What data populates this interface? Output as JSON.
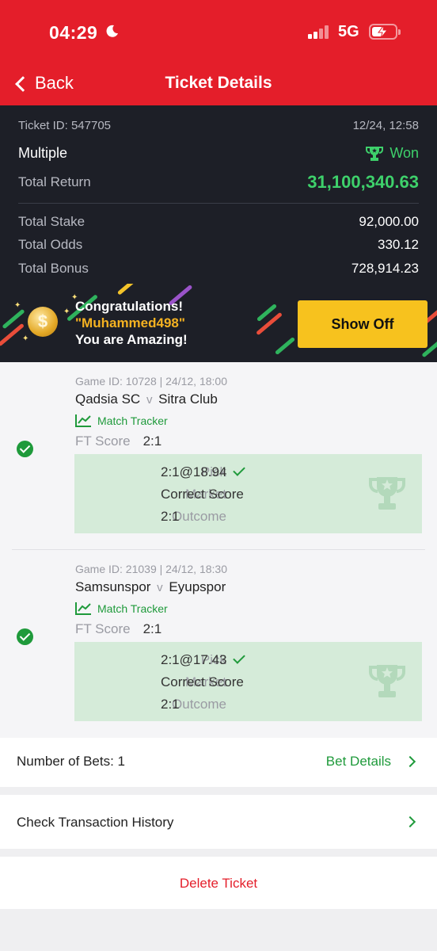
{
  "status_bar": {
    "time": "04:29",
    "network": "5G",
    "icons": [
      "moon-icon",
      "signal-icon",
      "battery-charging-icon"
    ]
  },
  "nav": {
    "back_label": "Back",
    "title": "Ticket Details"
  },
  "ticket": {
    "id_label": "Ticket ID: 547705",
    "datetime": "12/24, 12:58",
    "type": "Multiple",
    "status": "Won",
    "total_return_label": "Total Return",
    "total_return": "31,100,340.63",
    "total_stake_label": "Total Stake",
    "total_stake": "92,000.00",
    "total_odds_label": "Total Odds",
    "total_odds": "330.12",
    "total_bonus_label": "Total Bonus",
    "total_bonus": "728,914.23"
  },
  "promo": {
    "line1": "Congratulations!",
    "username": "\"Muhammed498\"",
    "line3": "You are Amazing!",
    "button": "Show Off"
  },
  "games": [
    {
      "game_id": "Game ID: 10728 | 24/12, 18:00",
      "home": "Qadsia SC",
      "vs": "v",
      "away": "Sitra Club",
      "tracker": "Match Tracker",
      "ft_label": "FT Score",
      "ft_score": "2:1",
      "pick_label": "Pick",
      "pick": "2:1@18.94",
      "market_label": "Market",
      "market": "Correct Score",
      "outcome_label": "Outcome",
      "outcome": "2:1"
    },
    {
      "game_id": "Game ID: 21039 | 24/12, 18:30",
      "home": "Samsunspor",
      "vs": "v",
      "away": "Eyupspor",
      "tracker": "Match Tracker",
      "ft_label": "FT Score",
      "ft_score": "2:1",
      "pick_label": "Pick",
      "pick": "2:1@17.43",
      "market_label": "Market",
      "market": "Correct Score",
      "outcome_label": "Outcome",
      "outcome": "2:1"
    }
  ],
  "bets": {
    "label": "Number of Bets: 1",
    "details": "Bet Details"
  },
  "history": {
    "label": "Check Transaction History"
  },
  "delete": {
    "label": "Delete Ticket"
  },
  "colors": {
    "brand_red": "#e41e2a",
    "won_green": "#3ed16b",
    "accent_green": "#1f9a3b",
    "showoff_yellow": "#f7c21e",
    "dark_bg": "#1d1f27"
  }
}
